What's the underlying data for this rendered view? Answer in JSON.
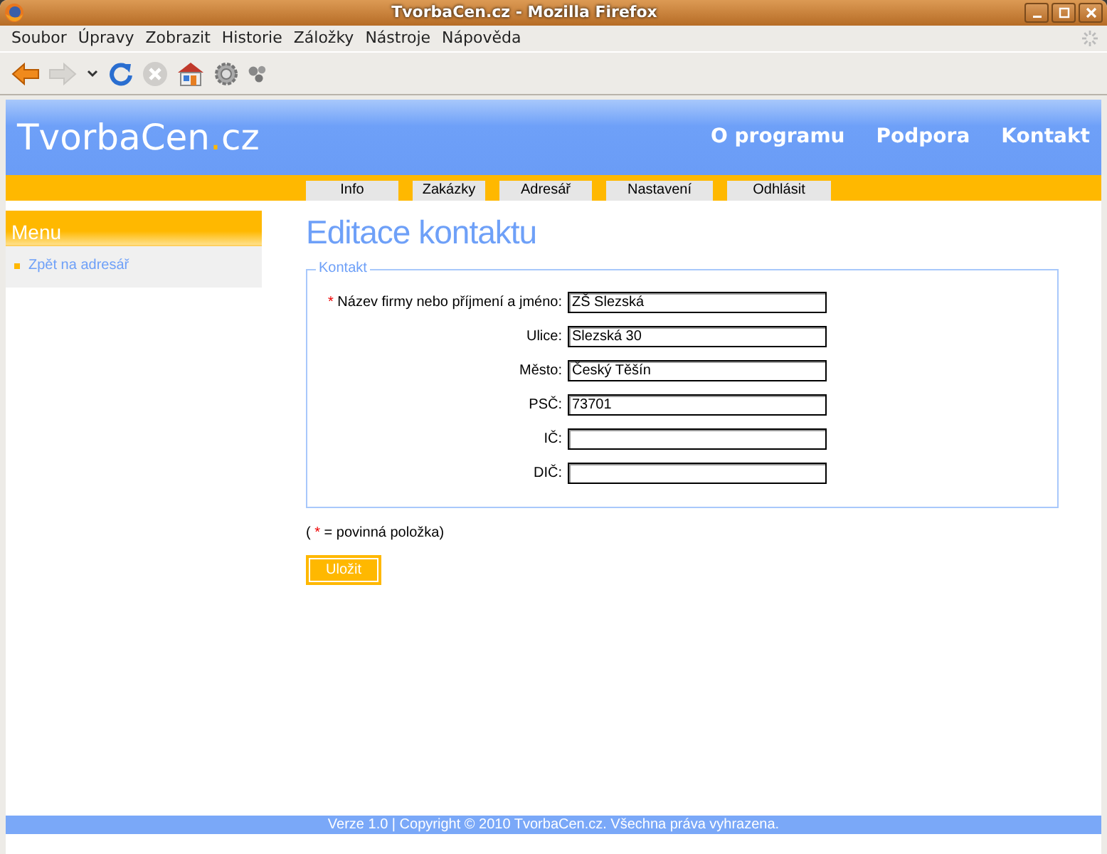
{
  "window": {
    "title": "TvorbaCen.cz - Mozilla Firefox"
  },
  "menubar": [
    {
      "label": "Soubor"
    },
    {
      "label": "Úpravy"
    },
    {
      "label": "Zobrazit"
    },
    {
      "label": "Historie"
    },
    {
      "label": "Záložky"
    },
    {
      "label": "Nástroje"
    },
    {
      "label": "Nápověda"
    }
  ],
  "toolbar": [
    {
      "kind": "back",
      "disabled": false
    },
    {
      "kind": "forward",
      "disabled": true
    },
    {
      "kind": "history"
    },
    {
      "kind": "reload",
      "disabled": false
    },
    {
      "kind": "stop",
      "disabled": true
    },
    {
      "kind": "home"
    },
    {
      "kind": "settings"
    },
    {
      "kind": "addon"
    }
  ],
  "site": {
    "logo": [
      {
        "kind": "name",
        "text": "TvorbaCen"
      },
      {
        "kind": "dot",
        "text": "."
      },
      {
        "kind": "tld",
        "text": "cz"
      }
    ],
    "top_links": [
      "O programu",
      "Podpora",
      "Kontakt"
    ],
    "tabs": [
      {
        "label": "Info",
        "selected": false
      },
      {
        "label": "Zakázky",
        "selected": false
      },
      {
        "label": "Adresář",
        "selected": false
      },
      {
        "label": "Nastavení",
        "selected": false
      },
      {
        "label": "Odhlásit",
        "selected": false
      }
    ],
    "sidebar": {
      "title": "Menu",
      "items": [
        "Zpět na adresář"
      ]
    },
    "heading": "Editace kontaktu",
    "fieldset": {
      "legend": "Kontakt",
      "fields": [
        {
          "label": "Název firmy nebo příjmení a jméno:",
          "value": "ZŠ Slezská",
          "required": true
        },
        {
          "label": "Ulice:",
          "value": "Slezská 30"
        },
        {
          "label": "Město:",
          "value": "Český Těšín"
        },
        {
          "label": "PSČ:",
          "value": "73701"
        },
        {
          "label": "IČ:"
        },
        {
          "label": "DIČ:"
        }
      ]
    },
    "required_mark": "*",
    "note": {
      "before": "(",
      "mark": "*",
      "after": "= povinná položka)"
    },
    "save_button": "Uložit",
    "footer": "Verze 1.0 | Copyright © 2010 TvorbaCen.cz. Všechna práva vyhrazena."
  }
}
